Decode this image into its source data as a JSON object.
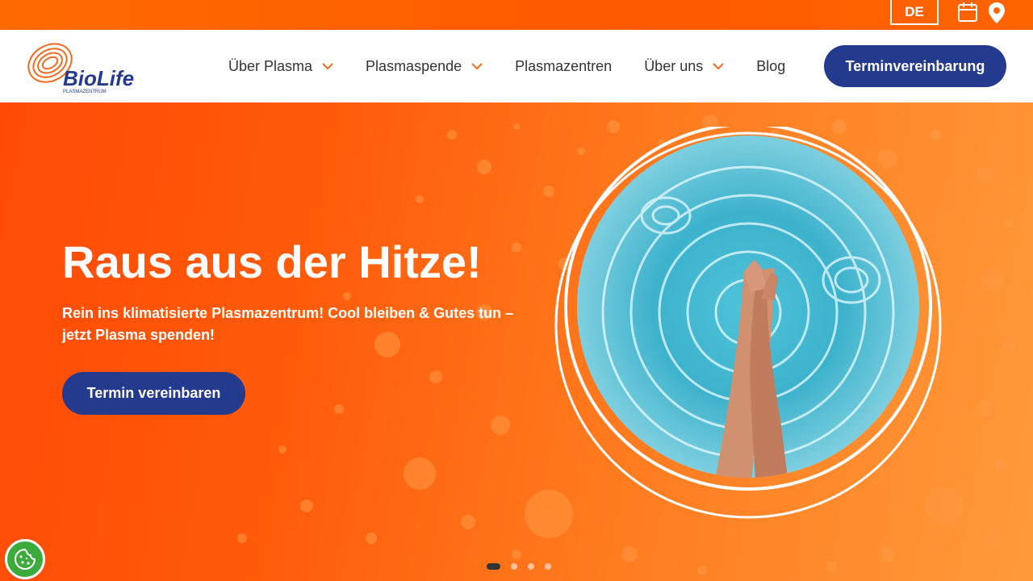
{
  "topbar": {
    "language": "DE",
    "calendar_icon": "calendar-icon",
    "location_icon": "map-pin-icon"
  },
  "header": {
    "logo_text": "BioLife",
    "logo_subtext": "PLASMAZENTRUM",
    "nav": [
      {
        "label": "Über Plasma",
        "has_dropdown": true
      },
      {
        "label": "Plasmaspende",
        "has_dropdown": true
      },
      {
        "label": "Plasmazentren",
        "has_dropdown": false
      },
      {
        "label": "Über uns",
        "has_dropdown": true
      },
      {
        "label": "Blog",
        "has_dropdown": false
      }
    ],
    "cta_label": "Terminvereinbarung"
  },
  "hero": {
    "title": "Raus aus der Hitze!",
    "subtitle": "Rein ins klimatisierte Plasmazentrum! Cool bleiben & Gutes tun – jetzt Plasma spenden!",
    "cta_label": "Termin vereinbaren",
    "slides_total": 4,
    "slide_active": 1
  },
  "colors": {
    "brand_orange": "#ff5a0a",
    "brand_blue": "#243a8f",
    "cookie_green": "#3daa3d"
  },
  "cookie_icon": "cookie-icon"
}
